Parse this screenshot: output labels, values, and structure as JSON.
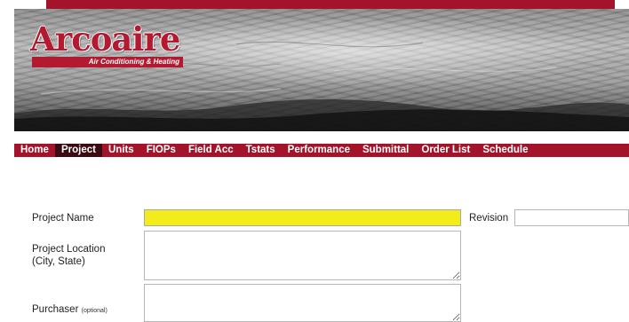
{
  "brand": {
    "name": "Arcoaire",
    "tagline": "Air Conditioning & Heating",
    "accent_color": "#a3142a",
    "highlight_color": "#f3ec1b"
  },
  "nav": {
    "items": [
      {
        "label": "Home"
      },
      {
        "label": "Project",
        "active": true
      },
      {
        "label": "Units"
      },
      {
        "label": "FIOPs"
      },
      {
        "label": "Field Acc"
      },
      {
        "label": "Tstats"
      },
      {
        "label": "Performance"
      },
      {
        "label": "Submittal"
      },
      {
        "label": "Order List"
      },
      {
        "label": "Schedule"
      }
    ]
  },
  "form": {
    "project_name_label": "Project Name",
    "project_name_value": "",
    "revision_label": "Revision",
    "revision_value": "",
    "project_location_label_line1": "Project Location",
    "project_location_label_line2": "(City, State)",
    "project_location_value": "",
    "purchaser_label": "Purchaser",
    "purchaser_optional": "(optional)",
    "purchaser_value": ""
  }
}
